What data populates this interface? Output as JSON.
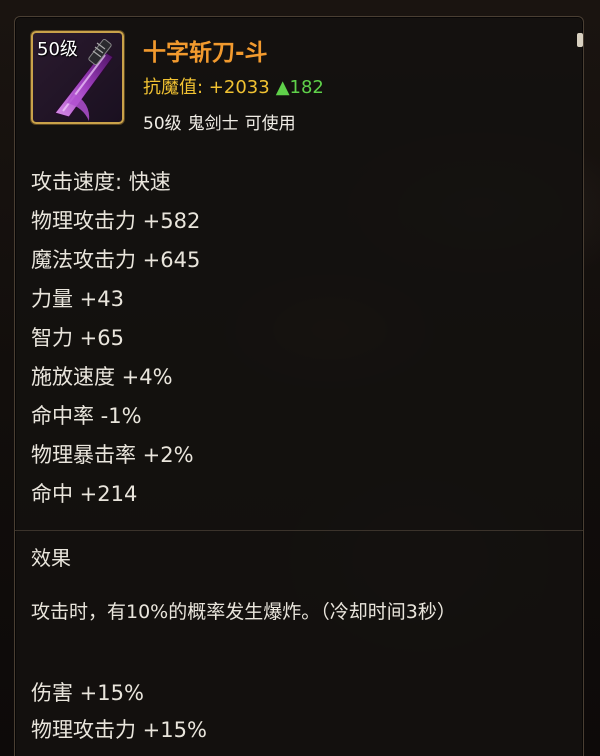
{
  "item": {
    "level_badge": "50级",
    "name": "十字斩刀-斗",
    "resist_label": "抗魔值: +2033",
    "resist_delta": "▲182",
    "level_requirement": [
      "50级",
      "鬼剑士",
      "可使用"
    ],
    "icon": "purple-katana-icon"
  },
  "stats": [
    "攻击速度: 快速",
    "物理攻击力 +582",
    "魔法攻击力 +645",
    "力量 +43",
    "智力 +65",
    "施放速度 +4%",
    "命中率 -1%",
    "物理暴击率 +2%",
    "命中 +214"
  ],
  "effect": {
    "title": "效果",
    "description": "攻击时，有10%的概率发生爆炸。（冷却时间3秒）",
    "lines": [
      "伤害 +15%",
      "物理攻击力 +15%"
    ]
  },
  "colors": {
    "name": "#f29a2e",
    "resist": "#f1c232",
    "delta_up": "#5fd14a",
    "frame": "#c9a24a"
  }
}
